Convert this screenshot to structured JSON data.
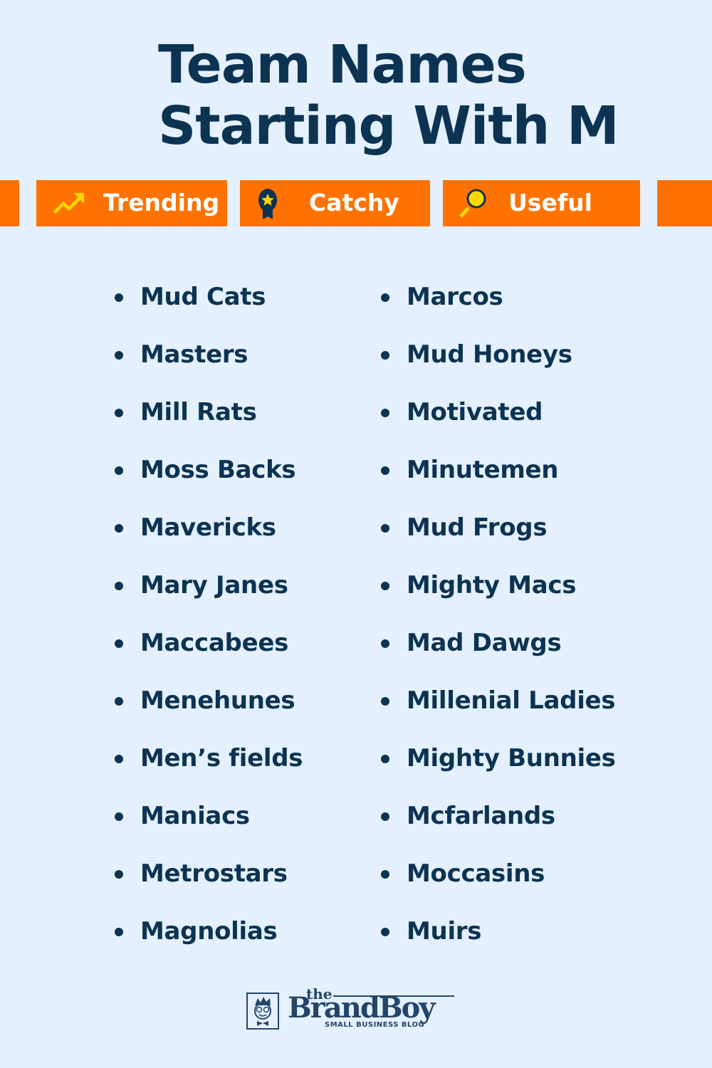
{
  "header": {
    "title_line1": "Team Names",
    "title_line2": "Starting With M"
  },
  "tags": [
    {
      "label": "Trending",
      "icon": "trending-up-icon"
    },
    {
      "label": "Catchy",
      "icon": "award-ribbon-star-icon"
    },
    {
      "label": "Useful",
      "icon": "magnifier-icon"
    }
  ],
  "colors": {
    "background": "#e4f0fd",
    "accent": "#ff7200",
    "text": "#0c3352",
    "icon_yellow": "#ffd700"
  },
  "names": {
    "column1": [
      "Mud Cats",
      "Masters",
      "Mill Rats",
      "Moss Backs",
      "Mavericks",
      "Mary Janes",
      "Maccabees",
      "Menehunes",
      "Men’s fields",
      "Maniacs",
      "Metrostars",
      "Magnolias"
    ],
    "column2": [
      "Marcos",
      "Mud Honeys",
      "Motivated",
      "Minutemen",
      "Mud Frogs",
      "Mighty Macs",
      "Mad Dawgs",
      "Millenial Ladies",
      "Mighty Bunnies",
      "Mcfarlands",
      "Moccasins",
      "Muirs"
    ]
  },
  "logo": {
    "prefix": "the",
    "name": "BrandBoy",
    "tagline": "SMALL BUSINESS BLOG"
  }
}
